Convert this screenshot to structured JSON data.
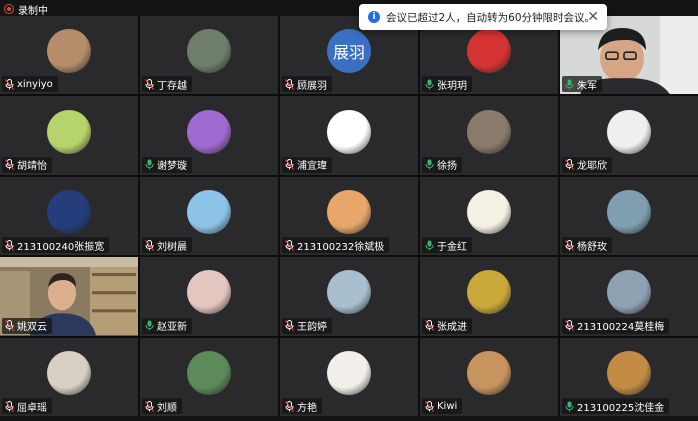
{
  "recording": {
    "label": "录制中"
  },
  "toast": {
    "message": "会议已超过2人，自动转为60分钟限时会议。",
    "close_glyph": "✕",
    "info_glyph": "i"
  },
  "participants": [
    {
      "name": "xinyiyo",
      "muted": true,
      "avatar_color": "#b58d6a"
    },
    {
      "name": "丁存越",
      "muted": true,
      "avatar_color": "#6f7e6a"
    },
    {
      "name": "顾展羽",
      "muted": true,
      "avatar_color": "#3b6fc1",
      "avatar_text": "展羽"
    },
    {
      "name": "张玥玥",
      "muted": false,
      "avatar_color": "#d63434"
    },
    {
      "name": "朱军",
      "muted": false,
      "video": true,
      "speaking": true
    },
    {
      "name": "胡靖怡",
      "muted": true,
      "avatar_color": "#b7d36b"
    },
    {
      "name": "谢梦璇",
      "muted": false,
      "avatar_color": "#a06ad0"
    },
    {
      "name": "浦宜瑋",
      "muted": true,
      "avatar_color": "#ffffff"
    },
    {
      "name": "徐扬",
      "muted": false,
      "avatar_color": "#8a7a6c"
    },
    {
      "name": "龙耶欣",
      "muted": true,
      "avatar_color": "#f1eeee"
    },
    {
      "name": "213100240张振宽",
      "muted": true,
      "avatar_color": "#253d7a"
    },
    {
      "name": "刘树晨",
      "muted": true,
      "avatar_color": "#8cc3e6"
    },
    {
      "name": "213100232徐斌极",
      "muted": true,
      "avatar_color": "#e8a66a"
    },
    {
      "name": "于金红",
      "muted": false,
      "avatar_color": "#f4f1e4"
    },
    {
      "name": "杨舒玫",
      "muted": true,
      "avatar_color": "#7f9fb0"
    },
    {
      "name": "姚双云",
      "muted": true,
      "video": true
    },
    {
      "name": "赵亚新",
      "muted": false,
      "avatar_color": "#e4c6c0"
    },
    {
      "name": "王韵婷",
      "muted": true,
      "avatar_color": "#a8bfcf"
    },
    {
      "name": "张成进",
      "muted": true,
      "avatar_color": "#c9a93a"
    },
    {
      "name": "213100224莫桂梅",
      "muted": true,
      "avatar_color": "#8fa2b4"
    },
    {
      "name": "屈卓瑶",
      "muted": true,
      "avatar_color": "#d8d0c4"
    },
    {
      "name": "刘顺",
      "muted": true,
      "avatar_color": "#5d8a5a"
    },
    {
      "name": "方艳",
      "muted": true,
      "avatar_color": "#f2eeea"
    },
    {
      "name": "Kiwi",
      "muted": true,
      "avatar_color": "#c7935f"
    },
    {
      "name": "213100225沈佳金",
      "muted": false,
      "avatar_color": "#c28c45"
    }
  ]
}
